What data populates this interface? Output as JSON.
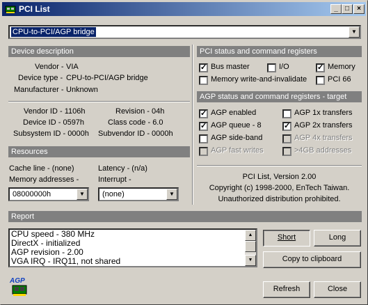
{
  "window": {
    "title": "PCI List",
    "icon": "pci-card-icon",
    "accent": "#0a246a"
  },
  "device_select": {
    "value": "CPU-to-PCI/AGP bridge"
  },
  "device_description": {
    "header": "Device description",
    "vendor_label": "Vendor -",
    "vendor": "VIA",
    "device_type_label": "Device type -",
    "device_type": "CPU-to-PCI/AGP bridge",
    "manufacturer_label": "Manufacturer -",
    "manufacturer": "Unknown"
  },
  "ids": {
    "vendor_id": "Vendor ID - 1106h",
    "device_id": "Device ID - 0597h",
    "subsystem_id": "Subsystem ID - 0000h",
    "revision": "Revision - 04h",
    "class_code": "Class code - 6.0",
    "subvendor_id": "Subvendor ID - 0000h"
  },
  "resources": {
    "header": "Resources",
    "cache_line": "Cache line - (none)",
    "latency": "Latency - (n/a)",
    "memory_label": "Memory addresses -",
    "memory_value": "08000000h",
    "interrupt_label": "Interrupt -",
    "interrupt_value": "(none)"
  },
  "pci_status": {
    "header": "PCI status and command registers",
    "bus_master": "Bus master",
    "io": "I/O",
    "memory": "Memory",
    "mwi": "Memory write-and-invalidate",
    "pci66": "PCI 66"
  },
  "agp_status": {
    "header": "AGP status and command registers - target",
    "agp_enabled": "AGP enabled",
    "agp_queue": "AGP queue - 8",
    "agp_sideband": "AGP side-band",
    "agp_fastwrites": "AGP fast writes",
    "agp_1x": "AGP 1x transfers",
    "agp_2x": "AGP 2x transfers",
    "agp_4x": "AGP 4x transfers",
    "above4gb": ">4GB addresses"
  },
  "about": {
    "version": "PCI List, Version 2.00",
    "copyright": "Copyright (c) 1998-2000, EnTech Taiwan.",
    "notice": "Unauthorized distribution prohibited."
  },
  "report": {
    "header": "Report",
    "lines": [
      "CPU speed - 380 MHz",
      "DirectX - initialized",
      "AGP revision - 2.00",
      "VGA IRQ - IRQ11, not shared"
    ],
    "short_label": "Short",
    "long_label": "Long",
    "copy_label": "Copy to clipboard"
  },
  "footer": {
    "logo_text": "AGP",
    "refresh_label": "Refresh",
    "close_label": "Close"
  }
}
